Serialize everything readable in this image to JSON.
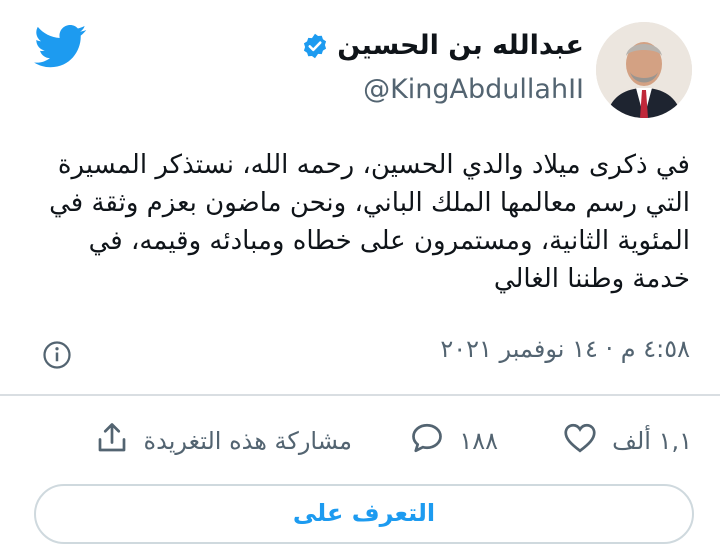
{
  "colors": {
    "twitter_blue": "#1d9bf0",
    "muted_text": "#536471",
    "divider": "#d9dee2"
  },
  "icons": {
    "logo": "twitter-bird-icon",
    "verified": "verified-badge-icon",
    "info": "info-icon",
    "like": "heart-icon",
    "reply": "reply-bubble-icon",
    "share": "share-upload-icon"
  },
  "author": {
    "name": "عبدالله بن الحسين",
    "handle": "@KingAbdullahII"
  },
  "tweet": {
    "text": "في ذكرى ميلاد والدي الحسين، رحمه الله، نستذكر المسيرة التي رسم معالمها الملك الباني، ونحن ماضون بعزم وثقة في المئوية الثانية، ومستمرون على خطاه ومبادئه وقيمه، في خدمة وطننا الغالي",
    "timestamp": "٤:٥٨ م · ١٤ نوفمبر ٢٠٢١"
  },
  "actions": {
    "likes": "١,١ ألف",
    "replies": "١٨٨",
    "share_label": "مشاركة هذه التغريدة"
  },
  "follow_button": {
    "label": "التعرف على"
  }
}
